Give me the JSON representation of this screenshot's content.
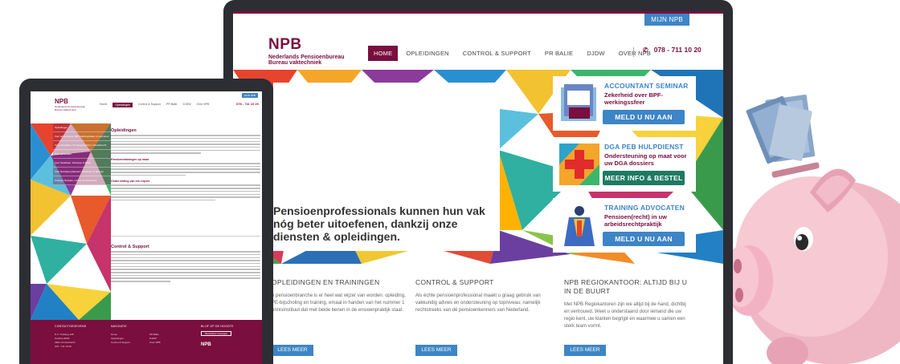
{
  "desktop": {
    "mijn_label": "MIJN NPB",
    "logo": {
      "mark": "NPB",
      "line1": "Nederlands Pensioenbureau",
      "line2": "Bureau vaktechniek"
    },
    "nav": [
      "HOME",
      "OPLEIDINGEN",
      "CONTROL & SUPPORT",
      "PR BALIE",
      "DJDW",
      "OVER NPB"
    ],
    "phone": "078 - 711 10 20",
    "hero_text": "Pensioenprofessionals kunnen hun vak nóg beter uitoefenen, dankzij onze diensten & opleidingen.",
    "promos": [
      {
        "title": "ACCOUNTANT SEMINAR",
        "subtitle": "Zekerheid over BPF-werkingssfeer",
        "button": "MELD U NU AAN",
        "badge": "BPF dossier",
        "button_color": "#3d85c6"
      },
      {
        "title": "DGA PEB HULPDIENST",
        "subtitle": "Ondersteuning op maat voor uw DGA dossiers",
        "button": "MEER INFO & BESTEL",
        "button_color": "#1e7a63"
      },
      {
        "title": "TRAINING ADVOCATEN",
        "subtitle": "Pensioen(recht) in uw arbeidsrechtpraktijk",
        "button": "MELD U NU AAN",
        "button_color": "#3d85c6"
      }
    ],
    "columns": [
      {
        "title": "OPLEIDINGEN EN TRAININGEN",
        "text": "e pensioenbranche is er heel wat wijzer van worden: opleiding, PE-bijscholing en training, emaal in handen van het nummer 1 ennisinstituut dat met beide benen in de ensioenpraktijk staat.",
        "button": "LEES MEER"
      },
      {
        "title": "CONTROL & SUPPORT",
        "text": "Als échte pensioenprofessional maakt u graag gebruik van vakkundig advies en ondersteuning op topniveau; namelijk rechtstreeks van dé pensioenkenners van Nederland.",
        "button": "LEES MEER"
      },
      {
        "title": "NPB REGIOKANTOOR: ALTIJD BIJ U IN DE BUURT",
        "text": "Met NPB Regiokantoren zijn we altijd bij de hand, dichtbij en vertrouwd. Weet u onderstaand door iemand die uw regio kent, uw klanten begrijpt en waarmee u samen een sterk team vormt.",
        "button": "LEES MEER"
      }
    ]
  },
  "tablet": {
    "logo": {
      "mark": "NPB",
      "line1": "Nederlands Pensioenbureau",
      "line2": "Bureau vaktechniek"
    },
    "mijn_label": "MIJN NPB",
    "nav": [
      "Home",
      "Opleidingen",
      "Control & Support",
      "PR Balie",
      "DJDW",
      "Over NPB"
    ],
    "phone": "078 - 711 10 20",
    "menu": [
      "Opleidingen",
      "Voor accountants: BPF-werkingssfeer en pensioen",
      "Voor advocaten: Pensioen(recht) in arbeidsrecht",
      "Voor advocaten",
      "Voor fiscalisten: Pensioen & DGA",
      "Voor financieel planners: Pensioen en lijfrente",
      "Overige: Sessies, cursus en incompany"
    ],
    "heading": "Opleidingen",
    "sub1": "Pensioentrainingen op maat",
    "sub2": "Onder leiding van een expert",
    "cs_heading": "Control & Support",
    "footer": {
      "h1": "CONTACTGEGEVENS",
      "h2": "NAVIGATIE",
      "h3": "BLIJF OP DE HOOGTE",
      "address": [
        "N.V. Trekweg 128",
        "Postbus 8029",
        "3301 CA Dordrecht",
        "078 - 711 10 20"
      ],
      "nav1": [
        "Home",
        "Opleidingen",
        "Control & Support"
      ],
      "nav2": [
        "PR Balie",
        "DJDW",
        "Over NPB"
      ],
      "button": "Nieuwsbrief ontvangen",
      "logo": "NPB"
    }
  }
}
